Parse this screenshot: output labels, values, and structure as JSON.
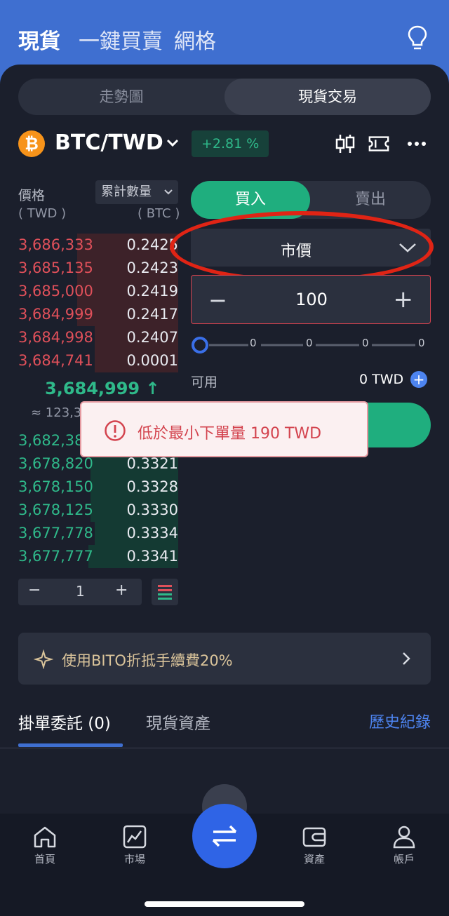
{
  "header": {
    "tabs": [
      "現貨",
      "一鍵買賣",
      "網格"
    ],
    "active_tab": "現貨"
  },
  "view_switch": {
    "options": [
      "走勢圖",
      "現貨交易"
    ],
    "active": "現貨交易"
  },
  "pair": {
    "icon": "bitcoin-icon",
    "coin_symbol": "₿",
    "name": "BTC/TWD",
    "change": "+2.81 %"
  },
  "orderbook": {
    "price_label": "價格",
    "price_unit": "( TWD )",
    "qty_selector": "累計數量",
    "qty_unit": "( BTC )",
    "asks": [
      {
        "price": "3,686,333",
        "qty": "0.2425",
        "depth": 0.63
      },
      {
        "price": "3,685,135",
        "qty": "0.2423",
        "depth": 0.63
      },
      {
        "price": "3,685,000",
        "qty": "0.2419",
        "depth": 0.63
      },
      {
        "price": "3,684,999",
        "qty": "0.2417",
        "depth": 0.63
      },
      {
        "price": "3,684,998",
        "qty": "0.2407",
        "depth": 0.52
      },
      {
        "price": "3,684,741",
        "qty": "0.0001",
        "depth": 0.52
      }
    ],
    "last_price": "3,684,999",
    "last_price_arrow": "↑",
    "approx_value": "≈ 123,3",
    "bids": [
      {
        "price": "3,682,38",
        "qty": "",
        "depth": 0.0
      },
      {
        "price": "3,678,820",
        "qty": "0.3321",
        "depth": 0.55
      },
      {
        "price": "3,678,150",
        "qty": "0.3328",
        "depth": 0.55
      },
      {
        "price": "3,678,125",
        "qty": "0.3330",
        "depth": 0.55
      },
      {
        "price": "3,677,778",
        "qty": "0.3334",
        "depth": 0.52
      },
      {
        "price": "3,677,777",
        "qty": "0.3341",
        "depth": 0.56
      }
    ],
    "precision_stepper": {
      "minus": "−",
      "value": "1",
      "plus": "+"
    }
  },
  "order_form": {
    "buy_label": "買入",
    "sell_label": "賣出",
    "order_type": "市價",
    "amount": "100",
    "minus": "−",
    "plus": "+",
    "slider_ticks": [
      "0",
      "0",
      "0",
      "0"
    ],
    "slider_value": 0,
    "available_label": "可用",
    "available_value": "0 TWD"
  },
  "toast": {
    "icon": "alert-circle-icon",
    "message": "低於最小下單量 190 TWD"
  },
  "promo": {
    "text": "使用BITO折抵手續費20%"
  },
  "orders_tabs": {
    "open_orders": "掛單委託 (0)",
    "assets": "現貨資產",
    "history": "歷史紀錄"
  },
  "bottom_nav": [
    {
      "label": "首頁",
      "icon": "home-icon"
    },
    {
      "label": "市場",
      "icon": "chart-icon"
    },
    {
      "label": "資產",
      "icon": "wallet-icon"
    },
    {
      "label": "帳戶",
      "icon": "user-icon"
    }
  ],
  "colors": {
    "brand": "#3f6fd0",
    "buy": "#1fae7e",
    "sell": "#e0505a",
    "bg": "#1b1f2c"
  }
}
